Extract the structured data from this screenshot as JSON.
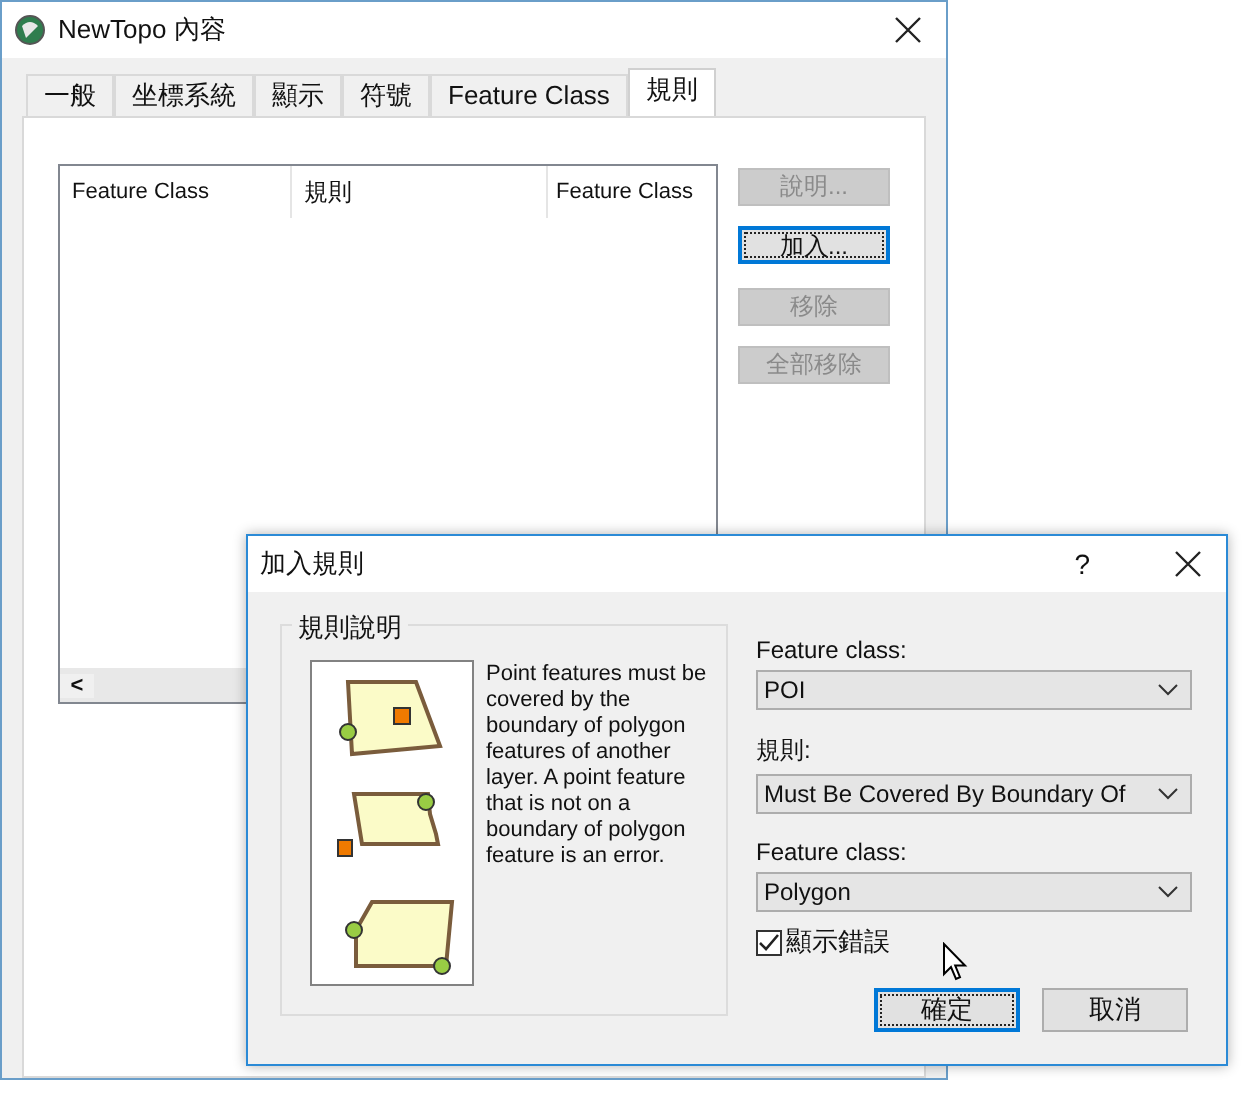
{
  "main_window": {
    "title": "NewTopo  內容",
    "tabs": [
      {
        "label": "一般",
        "selected": false
      },
      {
        "label": "坐標系統",
        "selected": false
      },
      {
        "label": "顯示",
        "selected": false
      },
      {
        "label": "符號",
        "selected": false
      },
      {
        "label": "Feature Class",
        "selected": false
      },
      {
        "label": "規則",
        "selected": true
      }
    ],
    "list": {
      "columns": [
        "Feature Class",
        "規則",
        "Feature Class"
      ],
      "scroll_left": "<"
    },
    "buttons": [
      {
        "label": "說明...",
        "disabled": true,
        "focused": false
      },
      {
        "label": "加入...",
        "disabled": false,
        "focused": true
      },
      {
        "label": "移除",
        "disabled": true,
        "focused": false
      },
      {
        "label": "全部移除",
        "disabled": true,
        "focused": false
      }
    ]
  },
  "dialog": {
    "title": "加入規則",
    "help": "?",
    "group": {
      "title": "規則說明",
      "description": "Point features must be covered by the boundary of polygon features of another layer. A point feature that is not on a boundary of polygon feature is an error."
    },
    "fields": [
      {
        "label": "Feature class:",
        "value": "POI"
      },
      {
        "label": "規則:",
        "value": "Must Be Covered By Boundary Of"
      },
      {
        "label": "Feature class:",
        "value": "Polygon"
      }
    ],
    "checkbox": {
      "label": "顯示錯誤",
      "checked": true
    },
    "buttons": [
      {
        "label": "確定",
        "focused": true
      },
      {
        "label": "取消",
        "focused": false
      }
    ]
  }
}
